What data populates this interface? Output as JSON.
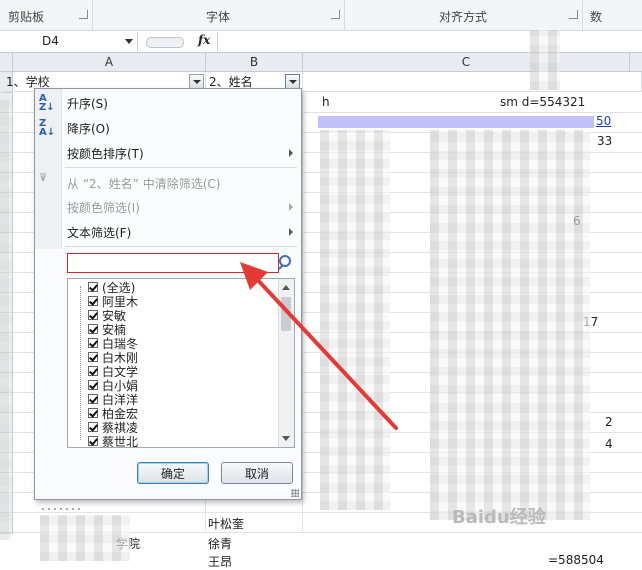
{
  "ribbon": {
    "groups": [
      {
        "label": "剪贴板"
      },
      {
        "label": "字体"
      },
      {
        "label": "对齐方式"
      },
      {
        "label": "数"
      }
    ]
  },
  "formula_bar": {
    "name_box": "D4",
    "fx_label": "fx",
    "formula": ""
  },
  "columns": {
    "a": "A",
    "b": "B",
    "c": "C"
  },
  "header_row": {
    "a": "1、学校",
    "b": "2、姓名"
  },
  "visible_cells": {
    "c_top": "h",
    "c_top_right": "sm   d=554321",
    "c_link_tail": "50",
    "c_33": "33",
    "c_6": "6",
    "c_17": "17",
    "c_2": "2",
    "c_4": "4",
    "row_b1": "叶松奎",
    "row_a2_tail": "学院",
    "row_b2": "徐青",
    "row_b3": "王昂",
    "row_c_last": "=588504"
  },
  "menu": {
    "sort_asc": "升序(S)",
    "sort_desc": "降序(O)",
    "sort_color": "按颜色排序(T)",
    "clear_filter": "从 “2、姓名” 中清除筛选(C)",
    "filter_color": "按颜色筛选(I)",
    "text_filter": "文本筛选(F)",
    "search_value": ""
  },
  "checklist": [
    "(全选)",
    "阿里木",
    "安敏",
    "安楠",
    "白瑞冬",
    "白木刚",
    "白文学",
    "白小娟",
    "白洋洋",
    "柏金宏",
    "蔡祺凌",
    "蔡世北"
  ],
  "buttons": {
    "ok": "确定",
    "cancel": "取消"
  },
  "watermark": "Baidu经验",
  "colors": {
    "annotation_arrow": "#e53935",
    "search_border": "#d02a2a",
    "link": "#1f3fbf"
  }
}
